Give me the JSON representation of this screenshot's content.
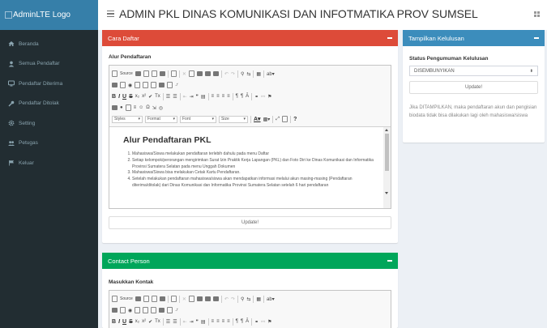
{
  "logo": "AdminLTE Logo",
  "sidebar": {
    "items": [
      {
        "label": "Beranda",
        "icon": "home-icon"
      },
      {
        "label": "Semua Pendaftar",
        "icon": "user-icon"
      },
      {
        "label": "Pendaftar Diterima",
        "icon": "monitor-icon"
      },
      {
        "label": "Pendaftar Ditolak",
        "icon": "wrench-icon"
      },
      {
        "label": "Setting",
        "icon": "gear-icon"
      },
      {
        "label": "Petugas",
        "icon": "users-icon"
      },
      {
        "label": "Keluar",
        "icon": "flag-icon"
      }
    ]
  },
  "header": {
    "title": "ADMIN PKL DINAS KOMUNIKASI DAN INFOTMATIKA PROV SUMSEL"
  },
  "cara_daftar": {
    "title": "Cara Daftar",
    "label": "Alur Pendaftaran",
    "heading": "Alur Pendaftaran PKL",
    "steps": [
      "Mahasiswa/Siswa melakukan pendaftaran terlebih dahulu pada menu Daftar",
      "Setiap kelompok/perorangan mengirimkan Surat Izin Praktik Kerja Lapangan (PKL) dan Foto Diri ke Dinas Komunikasi dan Informatika Provinsi Sumatera Selatan pada menu Unggah Dokumen",
      "Mahasiswa/Siswa bisa melakukan Cetak Kartu Pendaftaran.",
      "Setelah melakukan pendaftaran mahasiswa/siswa akan mendapatkan informasi melalui akun masing-masing (Pendaftaran diterima/ditolak) dari Dinas Komunikasi dan Informatika Provinsi Sumatera Selatan setelah 6 hari pendaftaran"
    ],
    "button": "Update!"
  },
  "contact": {
    "title": "Contact Person",
    "label": "Masukkan Kontak"
  },
  "kelulusan": {
    "title": "Tampilkan Kelulusan",
    "label": "Status Pengumuman Kelulusan",
    "selected": "DISEMBUNYIKAN",
    "button": "Update!",
    "note": "Jika DITAMPILKAN, maka pendaftaran akun dan pengisian biodata tidak bisa dilakukan lagi oleh mahasiswa/siswa"
  },
  "editor": {
    "source_label": "Source",
    "styles_label": "Styles",
    "format_label": "Format",
    "font_label": "Font",
    "size_label": "Size"
  },
  "colors": {
    "sidebar": "#222d32",
    "logo": "#367fa9",
    "red": "#dd4b39",
    "green": "#00a65a",
    "blue": "#3c8dbc"
  }
}
